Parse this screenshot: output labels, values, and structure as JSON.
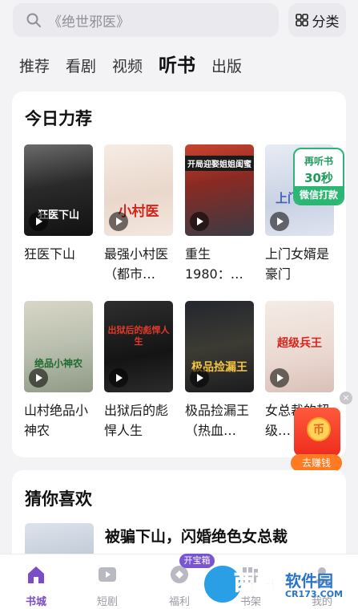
{
  "search": {
    "placeholder": "《绝世邪医》"
  },
  "category_button": {
    "label": "分类"
  },
  "tabs": [
    {
      "label": "推荐",
      "active": false
    },
    {
      "label": "看剧",
      "active": false
    },
    {
      "label": "视频",
      "active": false
    },
    {
      "label": "听书",
      "active": true
    },
    {
      "label": "出版",
      "active": false
    }
  ],
  "today_recommend": {
    "title": "今日力荐",
    "books": [
      {
        "title": "狂医下山",
        "cover_text": "狂医下山"
      },
      {
        "title": "最强小村医（都市…",
        "cover_text": "小村医"
      },
      {
        "title": "重生1980：…",
        "cover_text": "开局迎娶姐姐闺蜜"
      },
      {
        "title": "上门女婿是豪门",
        "cover_text": "上门豪门"
      },
      {
        "title": "山村绝品小神农",
        "cover_text": "绝品小神农"
      },
      {
        "title": "出狱后的彪悍人生",
        "cover_text": "出狱后的彪悍人生"
      },
      {
        "title": "极品捡漏王（热血…",
        "cover_text": "极品捡漏王"
      },
      {
        "title": "女总裁的超级…",
        "cover_text": "超级兵王"
      }
    ]
  },
  "relisten_badge": {
    "line1": "再听书",
    "line2": "30秒",
    "line3": "微信打款"
  },
  "red_packet": {
    "coin": "币",
    "label": "去赚钱"
  },
  "guess_you_like": {
    "title": "猜你喜欢",
    "first_item_title": "被骗下山，闪婚绝色女总裁"
  },
  "bottom_nav": [
    {
      "label": "书城",
      "active": true
    },
    {
      "label": "短剧",
      "active": false
    },
    {
      "label": "福利",
      "active": false
    },
    {
      "label": "书架",
      "active": false
    },
    {
      "label": "我的",
      "active": false
    }
  ],
  "treasure_badge": "开宝箱",
  "watermark": {
    "name": "西西",
    "soft": "软件园",
    "url": "CR173.COM"
  },
  "colors": {
    "accent": "#7a4cc8",
    "green": "#2bb673",
    "red": "#ee2c1e"
  }
}
